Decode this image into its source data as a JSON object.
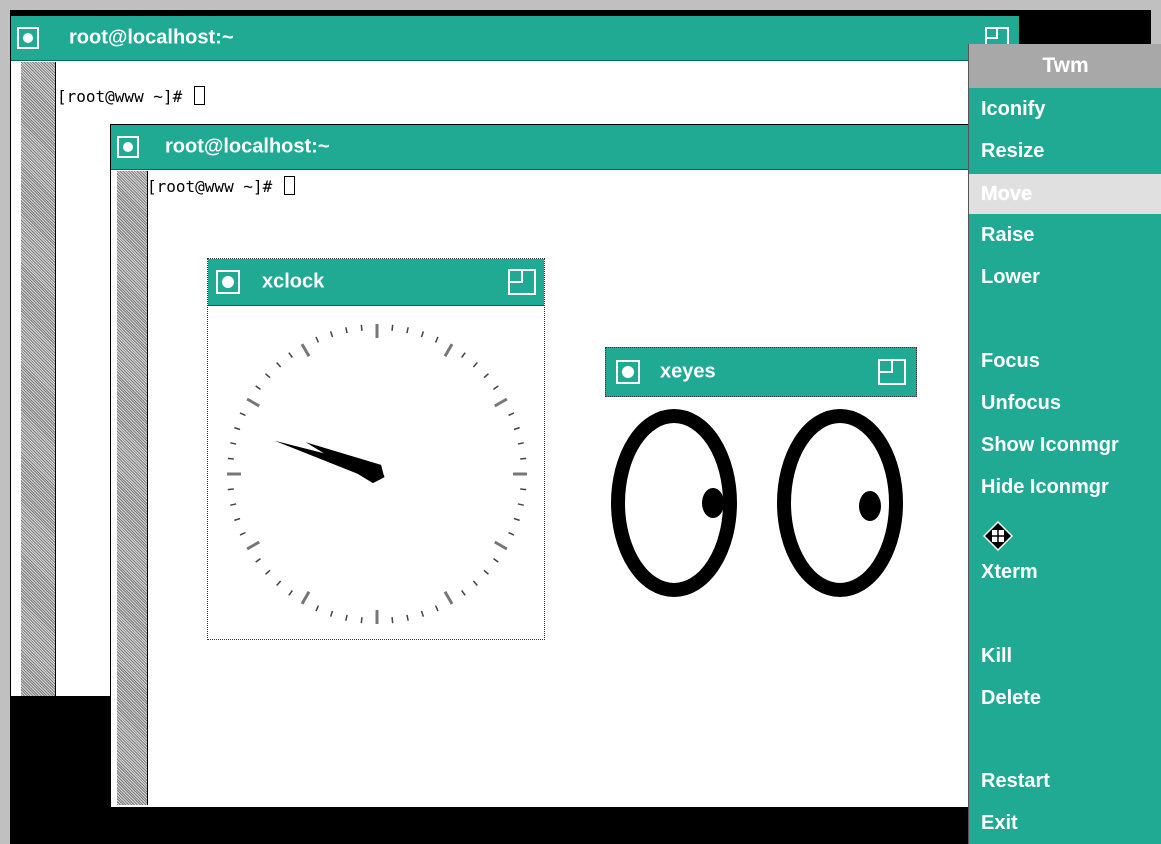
{
  "terminals": [
    {
      "title": "root@localhost:~",
      "prompt": "[root@www ~]# "
    },
    {
      "title": "root@localhost:~",
      "prompt": "[root@www ~]# "
    }
  ],
  "xclock": {
    "title": "xclock",
    "hour": 9,
    "minute": 48
  },
  "xeyes": {
    "title": "xeyes"
  },
  "twm_menu": {
    "title": "Twm",
    "items": [
      {
        "label": "Iconify",
        "active": false
      },
      {
        "label": "Resize",
        "active": false
      },
      {
        "label": "Move",
        "active": true
      },
      {
        "label": "Raise",
        "active": false
      },
      {
        "label": "Lower",
        "active": false
      },
      {
        "label": "Focus",
        "active": false
      },
      {
        "label": "Unfocus",
        "active": false
      },
      {
        "label": "Show Iconmgr",
        "active": false
      },
      {
        "label": "Hide Iconmgr",
        "active": false
      },
      {
        "label": "Xterm",
        "active": false
      },
      {
        "label": "Kill",
        "active": false
      },
      {
        "label": "Delete",
        "active": false
      },
      {
        "label": "Restart",
        "active": false
      },
      {
        "label": "Exit",
        "active": false
      }
    ]
  },
  "colors": {
    "titlebar": "#20aa94",
    "menu_bg": "#20aa94",
    "menu_title_bg": "#a8a8a8",
    "menu_highlight": "#e0e0e0",
    "desktop": "#000000"
  },
  "icons": [
    "window-menu-icon",
    "resize-icon",
    "move-cursor-icon"
  ]
}
